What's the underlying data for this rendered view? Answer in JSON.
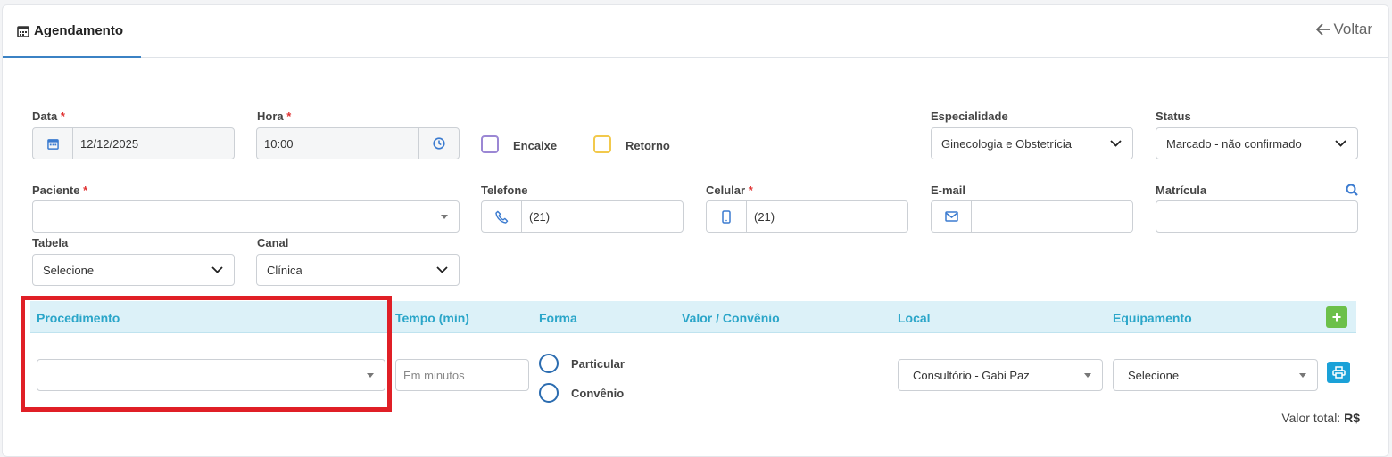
{
  "header": {
    "tab_label": "Agendamento",
    "back_label": "Voltar"
  },
  "form": {
    "data": {
      "label": "Data",
      "required": "*",
      "value": "12/12/2025"
    },
    "hora": {
      "label": "Hora",
      "required": "*",
      "value": "10:00"
    },
    "encaixe": {
      "label": "Encaixe",
      "checked": false
    },
    "retorno": {
      "label": "Retorno",
      "checked": false
    },
    "especialidade": {
      "label": "Especialidade",
      "value": "Ginecologia e Obstetrícia"
    },
    "status": {
      "label": "Status",
      "value": "Marcado - não confirmado"
    },
    "paciente": {
      "label": "Paciente",
      "required": "*",
      "value": ""
    },
    "telefone": {
      "label": "Telefone",
      "value": "(21)"
    },
    "celular": {
      "label": "Celular",
      "required": "*",
      "value": "(21)"
    },
    "email": {
      "label": "E-mail",
      "value": ""
    },
    "matricula": {
      "label": "Matrícula",
      "value": ""
    },
    "tabela": {
      "label": "Tabela",
      "value": "Selecione"
    },
    "canal": {
      "label": "Canal",
      "value": "Clínica"
    }
  },
  "procedures": {
    "headers": [
      "Procedimento",
      "Tempo (min)",
      "Forma",
      "Valor / Convênio",
      "Local",
      "Equipamento"
    ],
    "add_label": "+",
    "row": {
      "procedimento": "",
      "tempo_placeholder": "Em minutos",
      "forma_options": [
        "Particular",
        "Convênio"
      ],
      "local": "Consultório - Gabi Paz",
      "equipamento": "Selecione"
    },
    "total_label": "Valor total:",
    "total_currency": "R$"
  },
  "colors": {
    "accent": "#3b82c4",
    "header_bg": "#dcf1f8",
    "header_text": "#2ba6c9",
    "highlight": "#e01f26",
    "required": "#e03131"
  }
}
